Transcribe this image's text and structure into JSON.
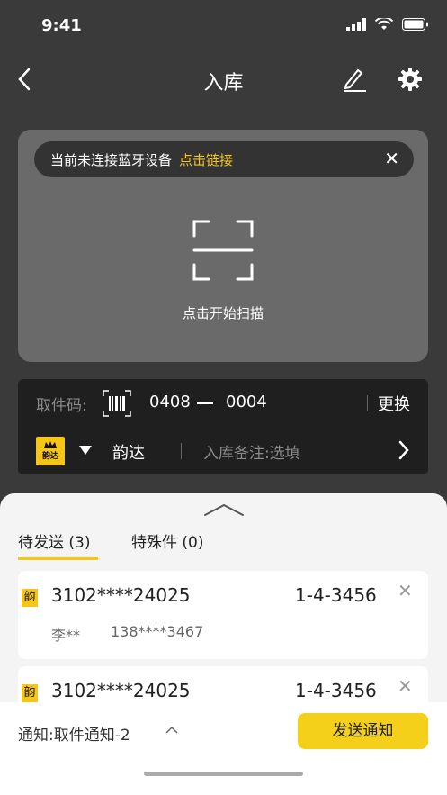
{
  "status_bar": {
    "time": "9:41"
  },
  "nav": {
    "title": "入库"
  },
  "bluetooth": {
    "message": "当前未连接蓝牙设备",
    "link": "点击链接",
    "close": "✕"
  },
  "scan": {
    "label": "点击开始扫描"
  },
  "pickup": {
    "label": "取件码:",
    "code_part1": "0408",
    "code_part2": "0004",
    "change": "更换",
    "logo_text": "韵达",
    "courier": "韵达",
    "remark_label": "入库备注:",
    "remark_placeholder": "选填"
  },
  "tabs": [
    {
      "label": "待发送 (3)",
      "active": true
    },
    {
      "label": "特殊件 (0)",
      "active": false
    }
  ],
  "items": [
    {
      "tag": "韵",
      "tracking": "3102****24025",
      "shelf": "1-4-3456",
      "name": "李**",
      "phone": "138****3467"
    },
    {
      "tag": "韵",
      "tracking": "3102****24025",
      "shelf": "1-4-3456"
    }
  ],
  "bottom": {
    "notify_label": "通知:",
    "notify_value": "取件通知-2",
    "send": "发送通知"
  },
  "colors": {
    "accent": "#f5c518",
    "background": "#3a3a3a",
    "card": "#6a6a6a"
  }
}
